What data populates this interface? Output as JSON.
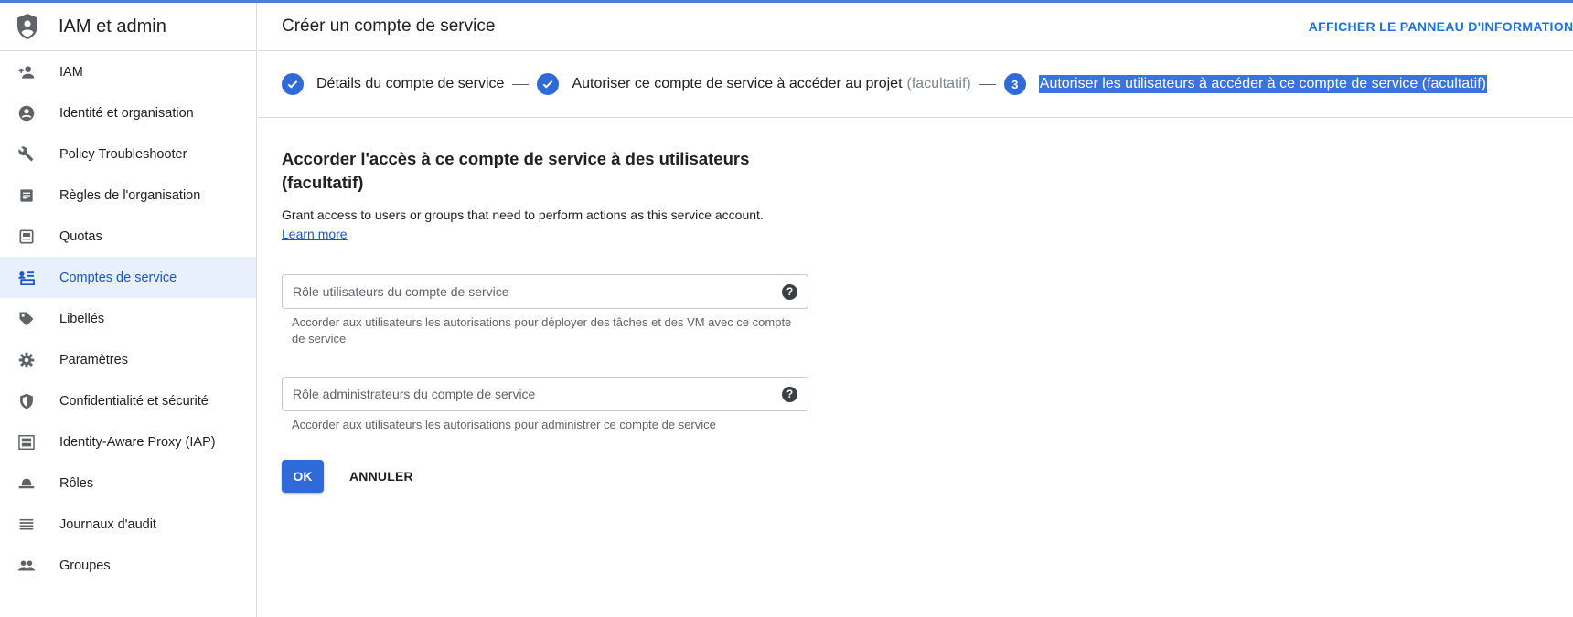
{
  "app": {
    "title": "IAM et admin"
  },
  "sidebar": {
    "items": [
      {
        "label": "IAM",
        "icon": "person-add-icon"
      },
      {
        "label": "Identité et organisation",
        "icon": "account-circle-icon"
      },
      {
        "label": "Policy Troubleshooter",
        "icon": "wrench-icon"
      },
      {
        "label": "Règles de l'organisation",
        "icon": "document-icon"
      },
      {
        "label": "Quotas",
        "icon": "quota-icon"
      },
      {
        "label": "Comptes de service",
        "icon": "service-account-icon",
        "active": true
      },
      {
        "label": "Libellés",
        "icon": "tag-icon"
      },
      {
        "label": "Paramètres",
        "icon": "gear-icon"
      },
      {
        "label": "Confidentialité et sécurité",
        "icon": "shield-icon"
      },
      {
        "label": "Identity-Aware Proxy (IAP)",
        "icon": "proxy-icon"
      },
      {
        "label": "Rôles",
        "icon": "hat-icon"
      },
      {
        "label": "Journaux d'audit",
        "icon": "list-icon"
      },
      {
        "label": "Groupes",
        "icon": "group-icon"
      }
    ]
  },
  "header": {
    "page_title": "Créer un compte de service",
    "info_panel": "AFFICHER LE PANNEAU D'INFORMATIONS"
  },
  "stepper": {
    "step1": {
      "label": "Détails du compte de service"
    },
    "step2": {
      "label": "Autoriser ce compte de service à accéder au projet",
      "optional": "(facultatif)"
    },
    "step3": {
      "number": "3",
      "label": "Autoriser les utilisateurs à accéder à ce compte de service (facultatif)"
    }
  },
  "content": {
    "title": "Accorder l'accès à ce compte de service à des utilisateurs (facultatif)",
    "description": "Grant access to users or groups that need to perform actions as this service account.",
    "learn_more": "Learn more",
    "field1": {
      "placeholder": "Rôle utilisateurs du compte de service",
      "hint": "Accorder aux utilisateurs les autorisations pour déployer des tâches et des VM avec ce compte de service"
    },
    "field2": {
      "placeholder": "Rôle administrateurs du compte de service",
      "hint": "Accorder aux utilisateurs les autorisations pour administrer ce compte de service"
    },
    "help_glyph": "?",
    "ok_label": "OK",
    "cancel_label": "ANNULER"
  },
  "colors": {
    "accent": "#2f6ad8",
    "active_bg": "#e8f0fe",
    "link": "#1a56c9"
  }
}
